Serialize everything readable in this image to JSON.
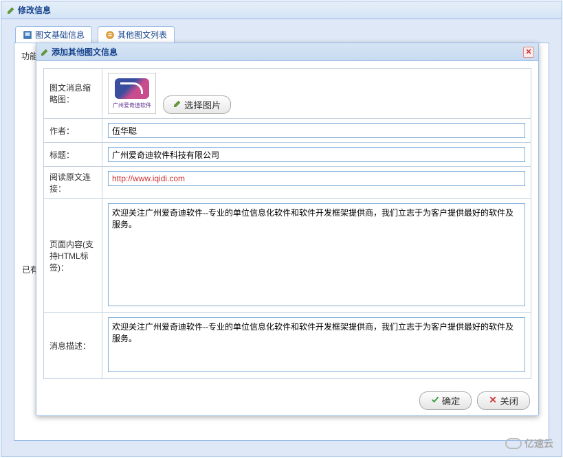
{
  "outer": {
    "title": "修改信息"
  },
  "tabs": [
    {
      "label": "图文基础信息"
    },
    {
      "label": "其他图文列表"
    }
  ],
  "background": {
    "func_label": "功能",
    "exist_label": "已有"
  },
  "modal": {
    "title": "添加其他图文信息",
    "thumb": {
      "label": "图文消息缩略图：",
      "caption": "广州爱奇迪软件",
      "select_btn": "选择图片"
    },
    "author": {
      "label": "作者：",
      "value": "伍华聪"
    },
    "title_field": {
      "label": "标题：",
      "value": "广州爱奇迪软件科技有限公司"
    },
    "url": {
      "label": "阅读原文连接：",
      "value": "http://www.iqidi.com"
    },
    "content": {
      "label": "页面内容(支持HTML标签)：",
      "value": "欢迎关注广州爱奇迪软件--专业的单位信息化软件和软件开发框架提供商，我们立志于为客户提供最好的软件及服务。"
    },
    "desc": {
      "label": "消息描述：",
      "value": "欢迎关注广州爱奇迪软件--专业的单位信息化软件和软件开发框架提供商，我们立志于为客户提供最好的软件及服务。"
    },
    "buttons": {
      "ok": "确定",
      "close": "关闭"
    }
  },
  "watermark": "亿速云"
}
